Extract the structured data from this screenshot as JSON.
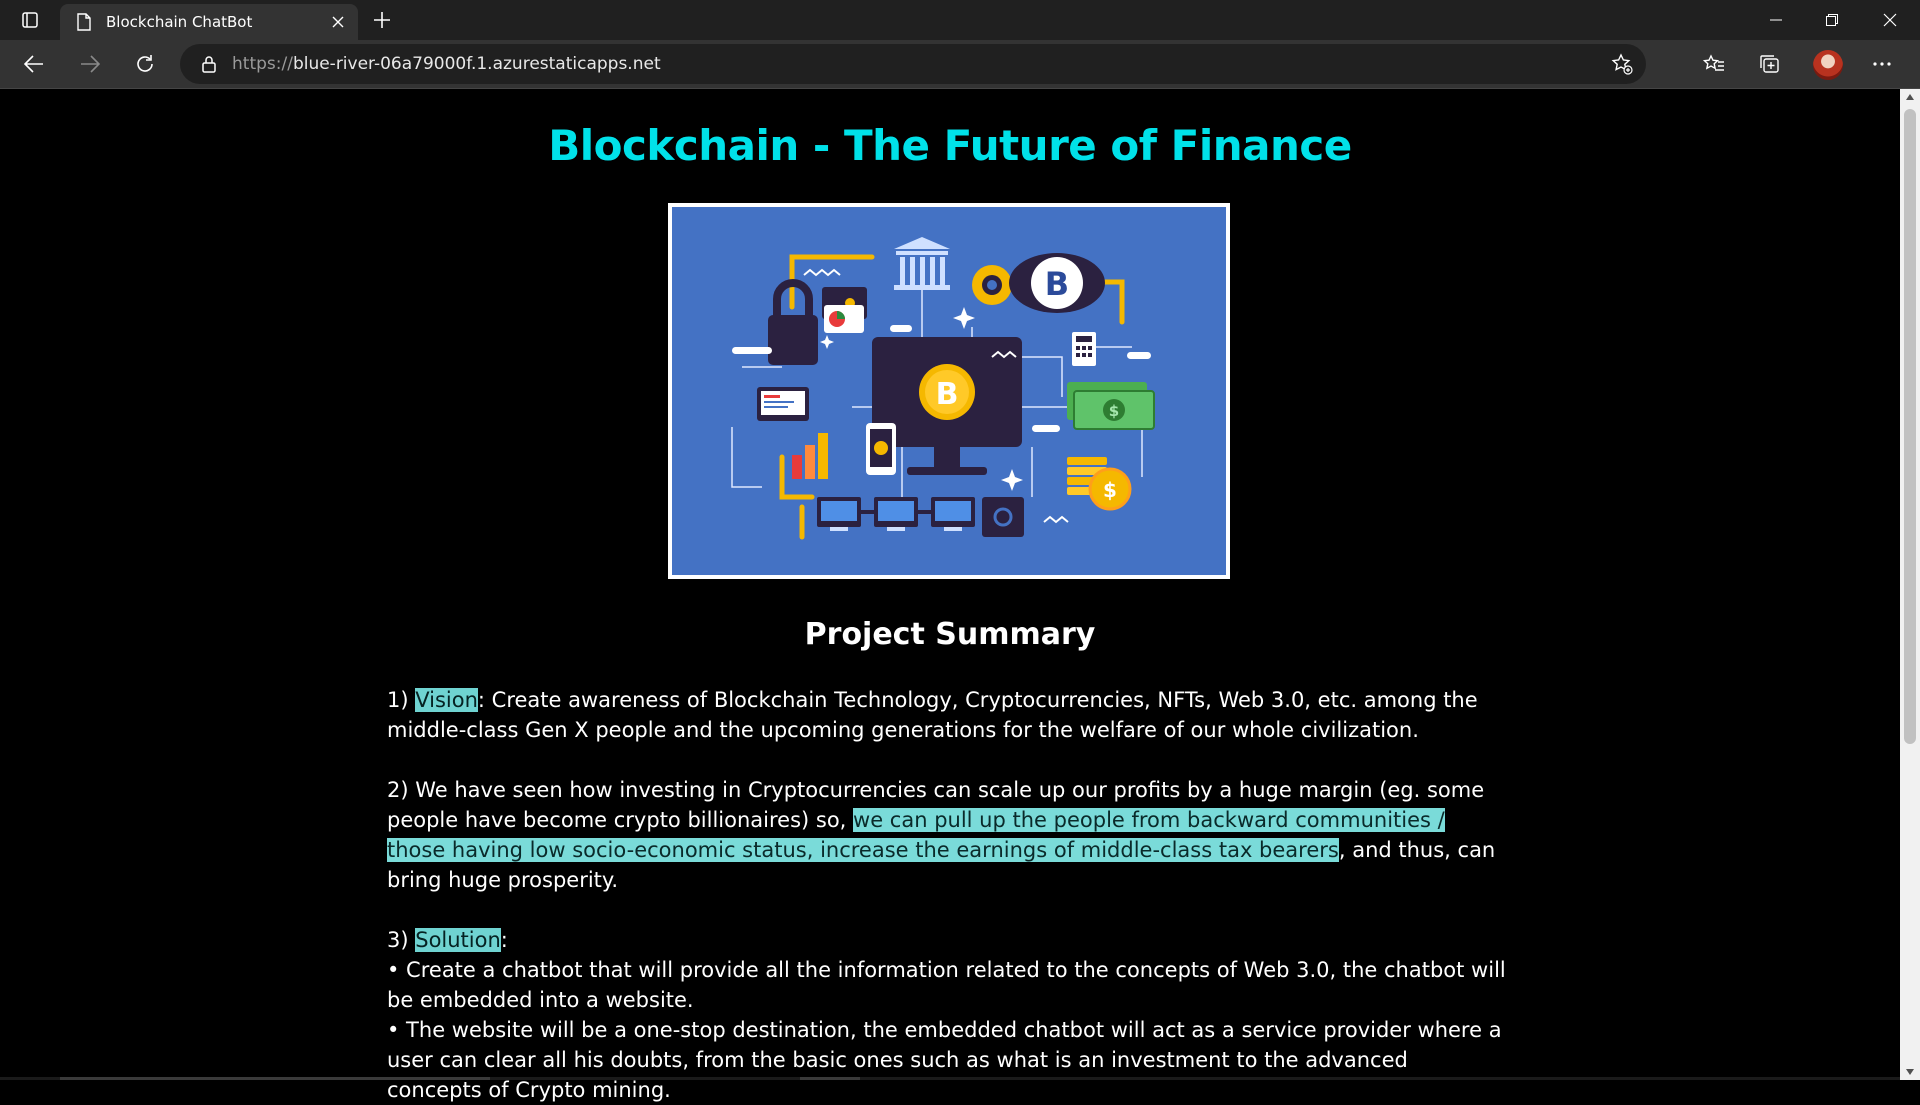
{
  "browser": {
    "tab_title": "Blockchain ChatBot",
    "url_protocol": "https://",
    "url_host": "blue-river-06a79000f.1.azurestaticapps.net"
  },
  "page": {
    "title": "Blockchain - The Future of Finance",
    "subtitle": "Project Summary",
    "p1": {
      "prefix": "1) ",
      "highlight": "Vision",
      "rest": ": Create awareness of Blockchain Technology, Cryptocurrencies, NFTs, Web 3.0, etc. among the middle-class Gen X people and the upcoming generations for the welfare of our whole civilization."
    },
    "p2": {
      "lead": "2) We have seen how investing in Cryptocurrencies can scale up our profits by a huge margin (eg. some people have become crypto billionaires) so, ",
      "highlight": "we can pull up the people from backward communities / those having low socio-economic status, increase the earnings of middle-class tax bearers",
      "tail": ", and thus, can bring huge prosperity."
    },
    "p3": {
      "prefix": "3) ",
      "highlight": "Solution",
      "suffix": ":",
      "bullet1": "• Create a chatbot that will provide all the information related to the concepts of Web 3.0, the chatbot will be embedded into a website.",
      "bullet2": "• The website will be a one-stop destination, the embedded chatbot will act as a service provider where a user can clear all his doubts, from the basic ones such as what is an investment to the advanced concepts of Crypto mining."
    }
  },
  "hero_image": {
    "icons": [
      "bank-icon",
      "gear-icon",
      "bitcoin-coin-icon",
      "padlock-icon",
      "calculator-icon",
      "cash-icon",
      "monitor-icon",
      "smartphone-icon",
      "bar-chart-icon",
      "gold-coins-icon",
      "server-rack-icon",
      "safe-icon"
    ],
    "colors": {
      "background": "#4472c4",
      "accent": "#f5b800",
      "dark": "#2b2140"
    }
  }
}
